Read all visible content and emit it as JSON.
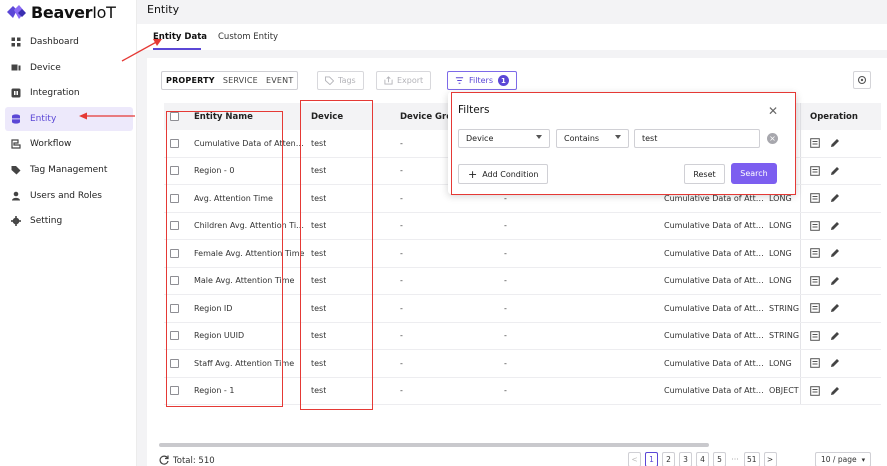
{
  "logo": {
    "brand": "Beaver",
    "suffix": "IoT"
  },
  "sidebar": {
    "items": [
      {
        "label": "Dashboard",
        "icon": "dashboard-icon",
        "active": false
      },
      {
        "label": "Device",
        "icon": "device-icon",
        "active": false
      },
      {
        "label": "Integration",
        "icon": "integration-icon",
        "active": false
      },
      {
        "label": "Entity",
        "icon": "entity-icon",
        "active": true
      },
      {
        "label": "Workflow",
        "icon": "workflow-icon",
        "active": false
      },
      {
        "label": "Tag Management",
        "icon": "tag-icon",
        "active": false
      },
      {
        "label": "Users and Roles",
        "icon": "user-icon",
        "active": false
      },
      {
        "label": "Setting",
        "icon": "gear-icon",
        "active": false
      }
    ]
  },
  "header": {
    "title": "Entity"
  },
  "tabs": [
    {
      "label": "Entity Data",
      "active": true
    },
    {
      "label": "Custom Entity",
      "active": false
    }
  ],
  "toolbar": {
    "segments": [
      "PROPERTY",
      "SERVICE",
      "EVENT"
    ],
    "active_segment": "PROPERTY",
    "tags_label": "Tags",
    "export_label": "Export",
    "filters_label": "Filters",
    "filters_count": "1"
  },
  "table": {
    "columns": [
      "Entity Name",
      "Device",
      "Device Group",
      "Operation"
    ],
    "rows": [
      {
        "name": "Cumulative Data of Atten…",
        "device": "test",
        "group": "-",
        "parent": "",
        "type": "CT"
      },
      {
        "name": "Region - 0",
        "device": "test",
        "group": "-",
        "parent": "",
        "type": "CT"
      },
      {
        "name": "Avg. Attention Time",
        "device": "test",
        "group": "-",
        "parent": "Cumulative Data of Att…",
        "type": "LONG"
      },
      {
        "name": "Children Avg. Attention Ti…",
        "device": "test",
        "group": "-",
        "parent": "Cumulative Data of Att…",
        "type": "LONG"
      },
      {
        "name": "Female Avg. Attention Time",
        "device": "test",
        "group": "-",
        "parent": "Cumulative Data of Att…",
        "type": "LONG"
      },
      {
        "name": "Male Avg. Attention Time",
        "device": "test",
        "group": "-",
        "parent": "Cumulative Data of Att…",
        "type": "LONG"
      },
      {
        "name": "Region ID",
        "device": "test",
        "group": "-",
        "parent": "Cumulative Data of Att…",
        "type": "STRING"
      },
      {
        "name": "Region UUID",
        "device": "test",
        "group": "-",
        "parent": "Cumulative Data of Att…",
        "type": "STRING"
      },
      {
        "name": "Staff Avg. Attention Time",
        "device": "test",
        "group": "-",
        "parent": "Cumulative Data of Att…",
        "type": "LONG"
      },
      {
        "name": "Region - 1",
        "device": "test",
        "group": "-",
        "parent": "Cumulative Data of Att…",
        "type": "OBJECT"
      }
    ]
  },
  "filter_popup": {
    "title": "Filters",
    "field": "Device",
    "operator": "Contains",
    "value": "test",
    "add_condition_label": "Add Condition",
    "reset_label": "Reset",
    "search_label": "Search"
  },
  "footer": {
    "total": "Total: 510",
    "pages": [
      "1",
      "2",
      "3",
      "4",
      "5",
      "···",
      "51"
    ],
    "current_page": "1",
    "page_size": "10 / page"
  },
  "colors": {
    "accent": "#5b47d6",
    "search_button": "#7c5ef0",
    "annotation": "#e53935"
  }
}
